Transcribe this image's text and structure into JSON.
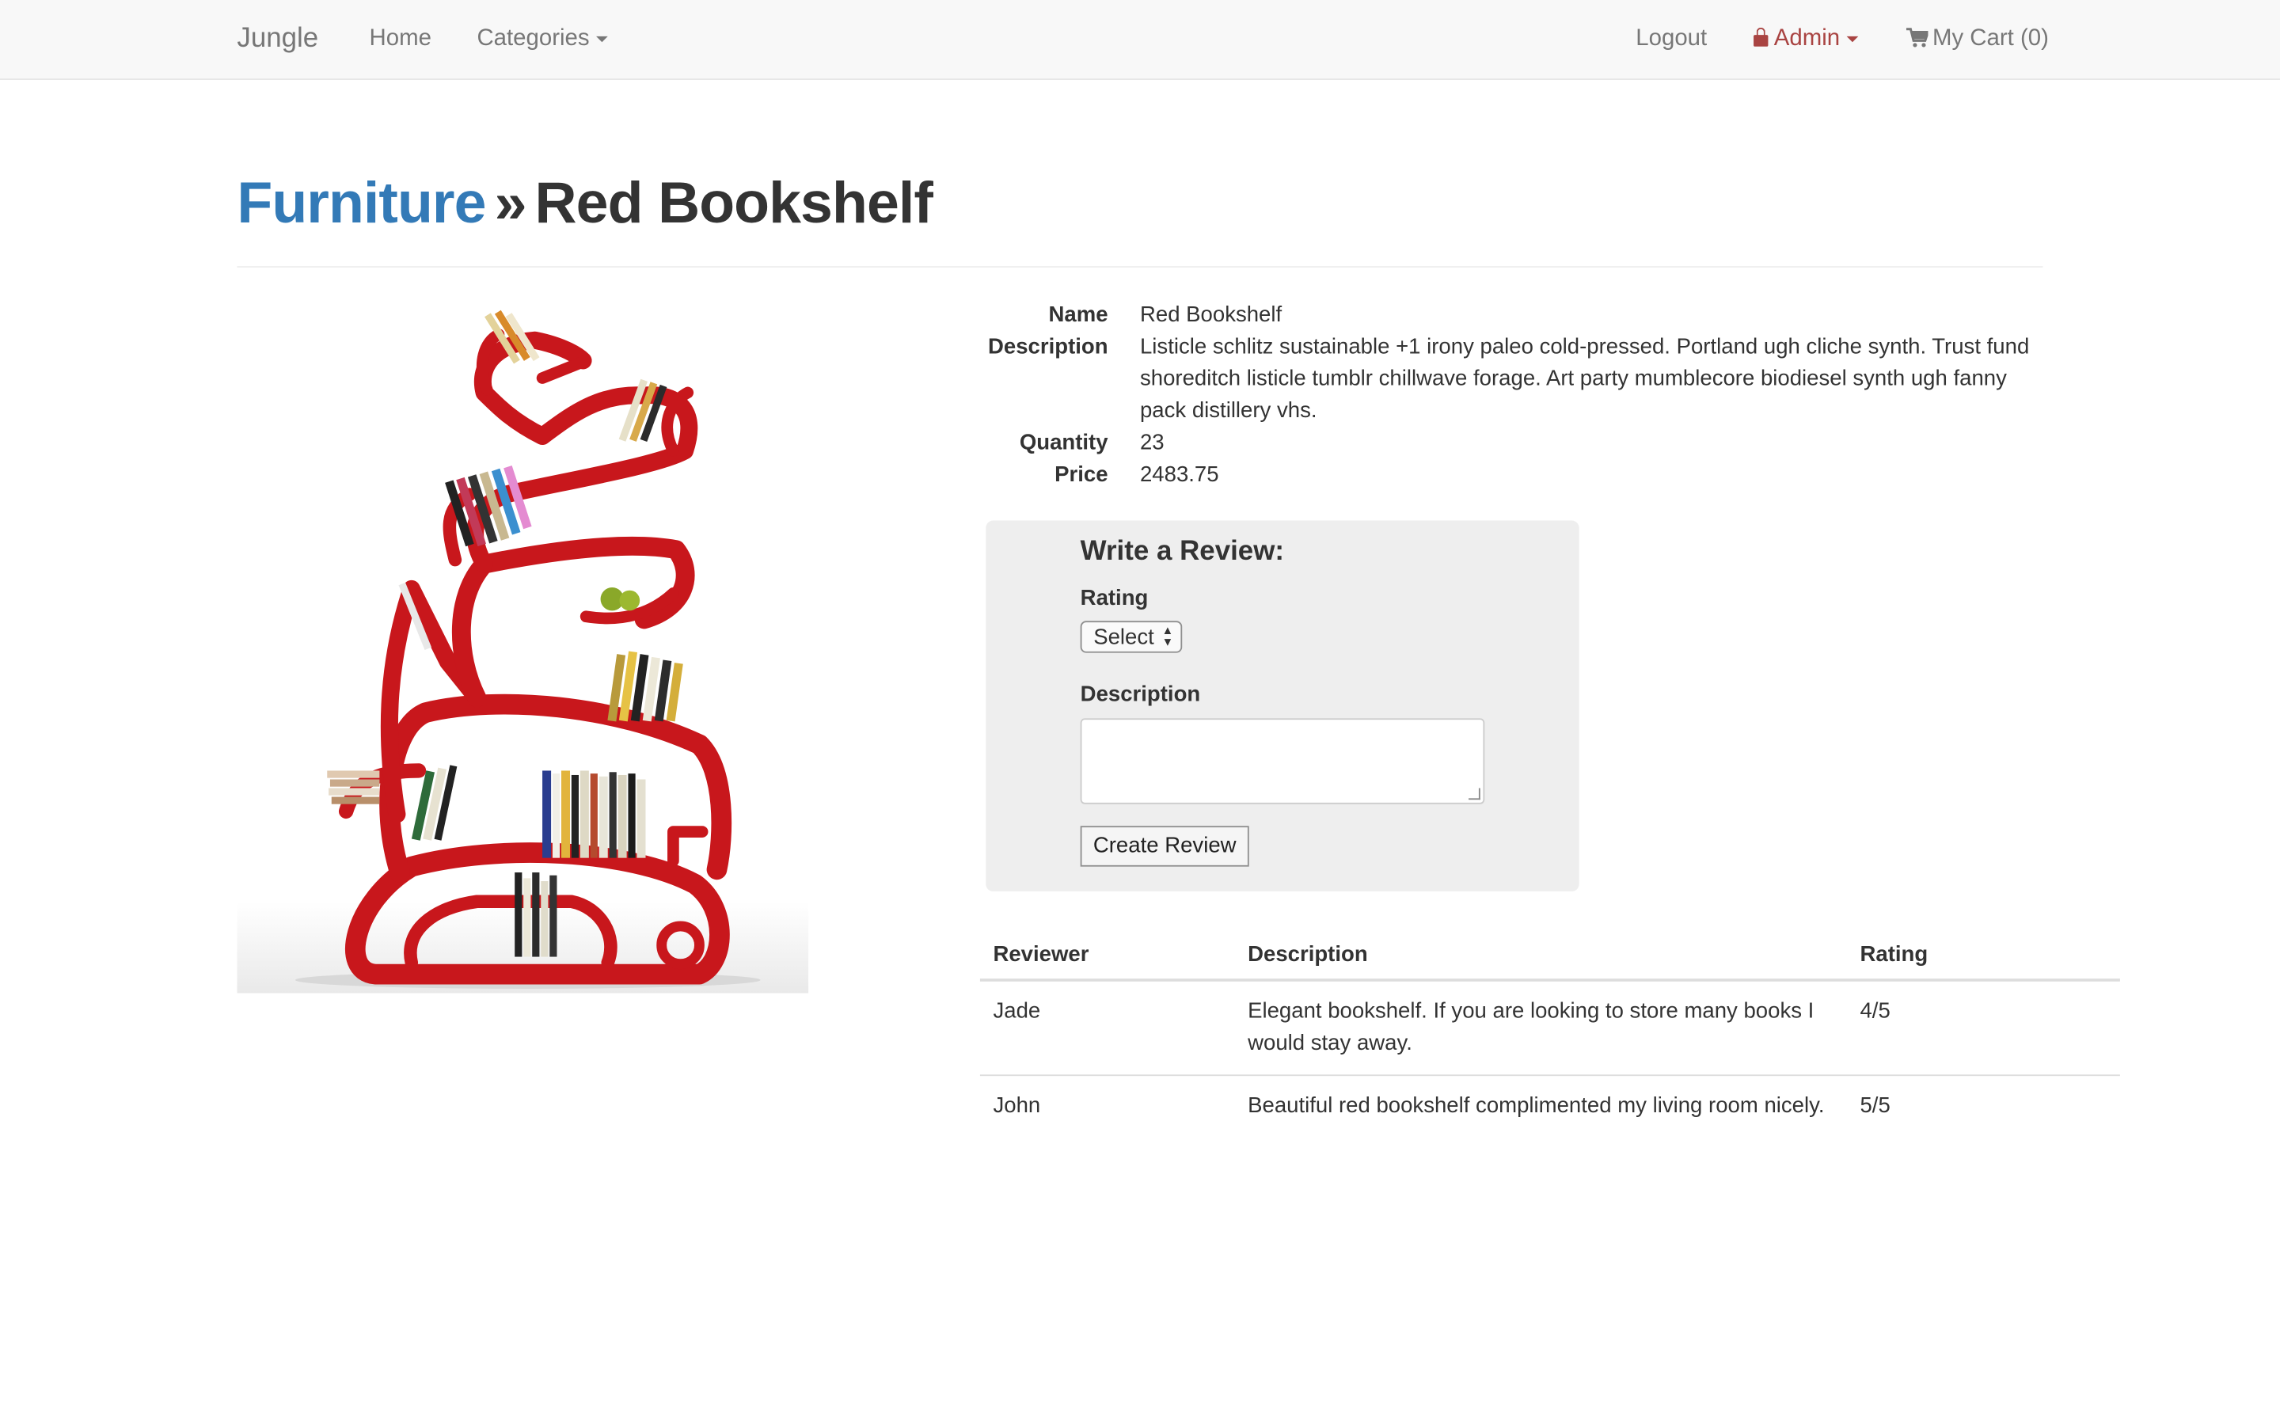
{
  "navbar": {
    "brand": "Jungle",
    "home": "Home",
    "categories": "Categories",
    "logout": "Logout",
    "admin": "Admin",
    "cart": "My Cart (0)",
    "admin_color": "#a94442"
  },
  "header": {
    "category": "Furniture",
    "separator": "»",
    "title": "Red Bookshelf"
  },
  "product": {
    "name_label": "Name",
    "name": "Red Bookshelf",
    "description_label": "Description",
    "description": "Listicle schlitz sustainable +1 irony paleo cold-pressed. Portland ugh cliche synth. Trust fund shoreditch listicle tumblr chillwave forage. Art party mumblecore biodiesel synth ugh fanny pack distillery vhs.",
    "quantity_label": "Quantity",
    "quantity": "23",
    "price_label": "Price",
    "price": "2483.75"
  },
  "review_form": {
    "title": "Write a Review:",
    "rating_label": "Rating",
    "rating_selected": "Select",
    "description_label": "Description",
    "description_value": "",
    "submit": "Create Review"
  },
  "reviews": {
    "headers": [
      "Reviewer",
      "Description",
      "Rating"
    ],
    "rows": [
      {
        "reviewer": "Jade",
        "description": "Elegant bookshelf. If you are looking to store many books I would stay away.",
        "rating": "4/5"
      },
      {
        "reviewer": "John",
        "description": "Beautiful red bookshelf complimented my living room nicely.",
        "rating": "5/5"
      }
    ]
  },
  "colors": {
    "link": "#337ab7",
    "shelf": "#c8171c"
  }
}
